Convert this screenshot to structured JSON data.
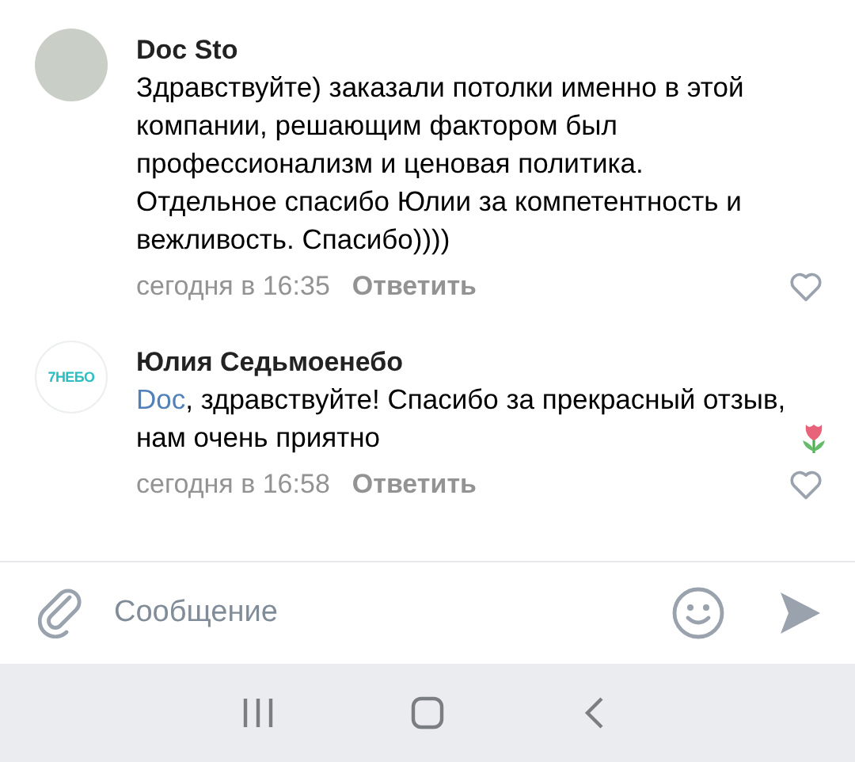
{
  "comments": [
    {
      "author": "Doc Sto",
      "avatar": {
        "kind": "photo"
      },
      "text": "Здравствуйте) заказали потолки именно в этой компании, решающим фактором был профессионализм и ценовая политика. Отдельное спасибо Юлии за компетентность и вежливость. Спасибо))))",
      "time": "сегодня в 16:35",
      "reply": "Ответить",
      "liked": false
    },
    {
      "author": "Юлия Седьмоенебо",
      "avatar": {
        "kind": "logo",
        "text": "7НЕБО"
      },
      "mention": "Doc",
      "text": ", здравствуйте! Спасибо за прекрасный отзыв, нам очень приятно",
      "emoji": {
        "kind": "tulip"
      },
      "time": "сегодня в 16:58",
      "reply": "Ответить",
      "liked": false
    }
  ],
  "composer": {
    "placeholder": "Сообщение"
  }
}
